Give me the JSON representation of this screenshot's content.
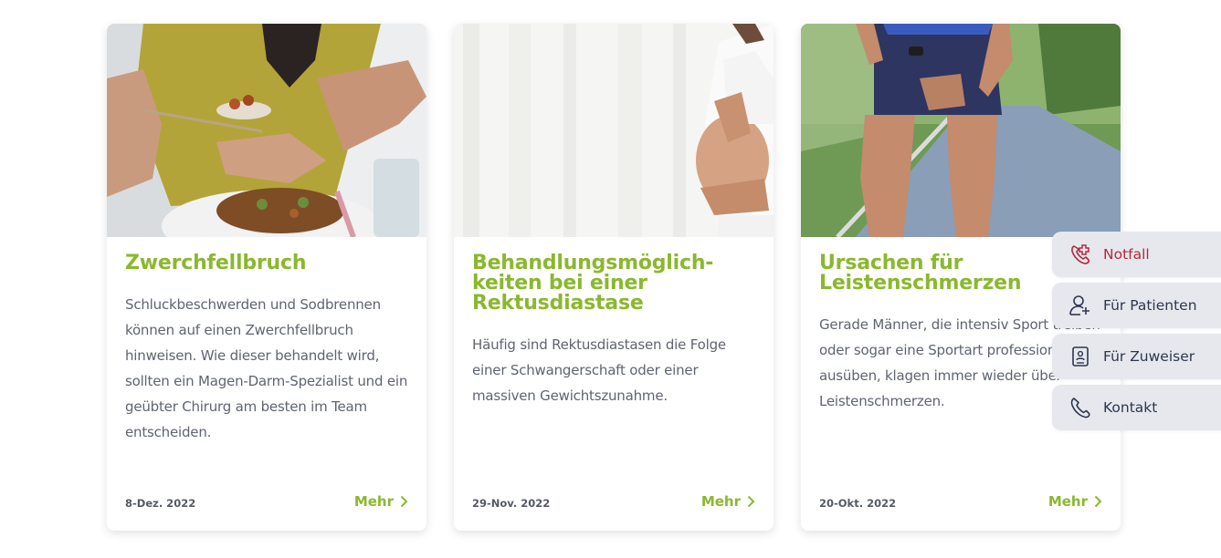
{
  "cards": [
    {
      "title": "Zwerchfellbruch",
      "text": "Schluckbeschwerden und Sodbrennen können auf einen Zwerchfellbruch hinweisen. Wie dieser behandelt wird, sollten ein Magen-Darm-Spezialist und ein geübter Chirurg am besten im Team entscheiden.",
      "date": "8-Dez. 2022",
      "more": "Mehr"
    },
    {
      "title": "Behandlungsmöglich-keiten bei einer Rektusdiastase",
      "text": "Häufig sind Rektusdiastasen die Folge einer Schwangerschaft oder einer massiven Gewichtszunahme.",
      "date": "29-Nov. 2022",
      "more": "Mehr"
    },
    {
      "title": "Ursachen für Leistenschmerzen",
      "text": "Gerade Männer, die intensiv Sport treiben oder sogar eine Sportart professionell ausüben, klagen immer wieder über Leistenschmerzen.",
      "date": "20-Okt. 2022",
      "more": "Mehr"
    }
  ],
  "side_menu": [
    {
      "label": "Notfall",
      "icon": "emergency-phone-icon"
    },
    {
      "label": "Für Patienten",
      "icon": "user-plus-icon"
    },
    {
      "label": "Für Zuweiser",
      "icon": "id-badge-icon"
    },
    {
      "label": "Kontakt",
      "icon": "phone-icon"
    }
  ],
  "colors": {
    "accent_green": "#8ab82e",
    "text_gray": "#5f6470",
    "side_bg": "#e6e8ed",
    "side_text": "#2e3650",
    "emergency_red": "#b5283c"
  }
}
